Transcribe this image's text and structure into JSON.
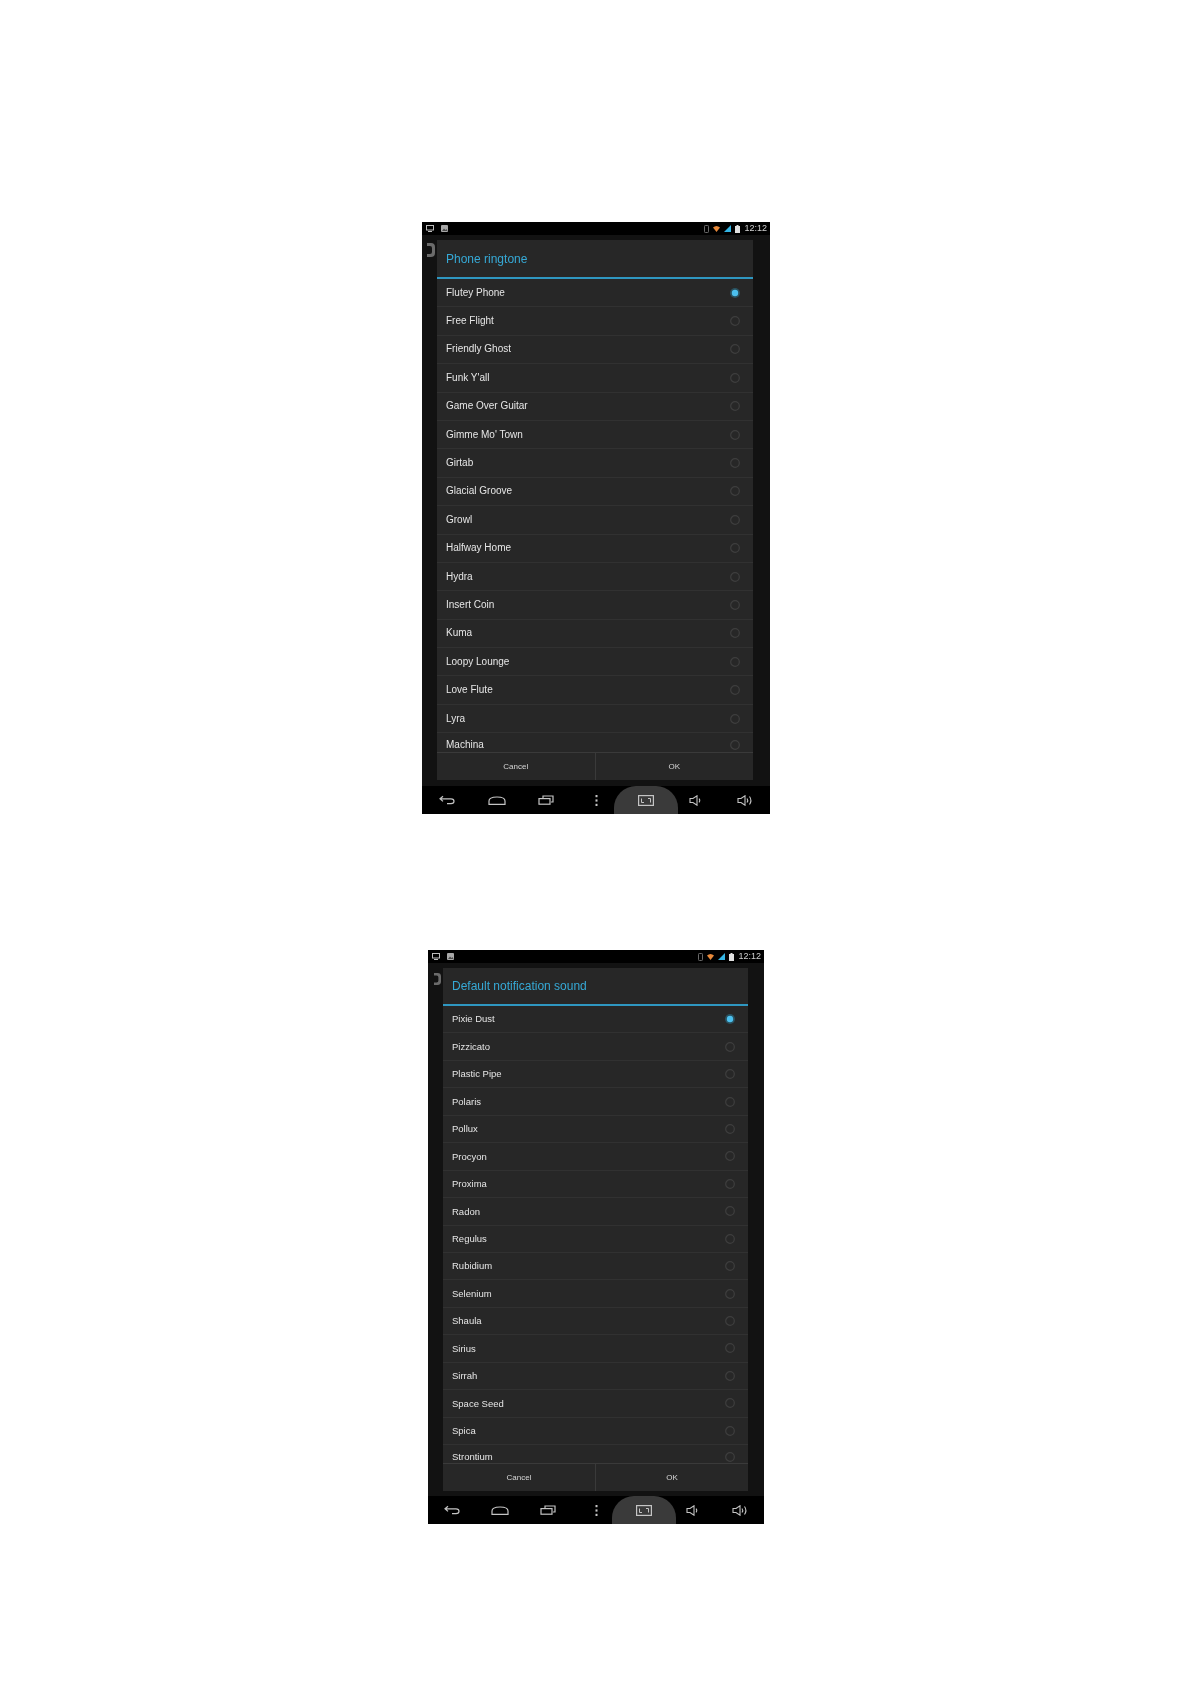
{
  "screens": [
    {
      "status_bar": {
        "time": "12:12"
      },
      "dialog": {
        "title": "Phone ringtone",
        "options": [
          {
            "label": "Flutey Phone",
            "selected": true
          },
          {
            "label": "Free Flight",
            "selected": false
          },
          {
            "label": "Friendly Ghost",
            "selected": false
          },
          {
            "label": "Funk Y'all",
            "selected": false
          },
          {
            "label": "Game Over Guitar",
            "selected": false
          },
          {
            "label": "Gimme Mo' Town",
            "selected": false
          },
          {
            "label": "Girtab",
            "selected": false
          },
          {
            "label": "Glacial Groove",
            "selected": false
          },
          {
            "label": "Growl",
            "selected": false
          },
          {
            "label": "Halfway Home",
            "selected": false
          },
          {
            "label": "Hydra",
            "selected": false
          },
          {
            "label": "Insert Coin",
            "selected": false
          },
          {
            "label": "Kuma",
            "selected": false
          },
          {
            "label": "Loopy Lounge",
            "selected": false
          },
          {
            "label": "Love Flute",
            "selected": false
          },
          {
            "label": "Lyra",
            "selected": false
          },
          {
            "label": "Machina",
            "selected": false
          }
        ],
        "buttons": [
          "Cancel",
          "OK"
        ]
      },
      "nav_bar": [
        {
          "kind": "back",
          "pressed": false
        },
        {
          "kind": "home",
          "pressed": false
        },
        {
          "kind": "recent",
          "pressed": false
        },
        {
          "kind": "menu",
          "pressed": false
        },
        {
          "kind": "capture",
          "pressed": true
        },
        {
          "kind": "volume_down",
          "pressed": false
        },
        {
          "kind": "volume_up",
          "pressed": false
        }
      ]
    },
    {
      "status_bar": {
        "time": "12:12"
      },
      "dialog": {
        "title": "Default notification sound",
        "options": [
          {
            "label": "Pixie Dust",
            "selected": true
          },
          {
            "label": "Pizzicato",
            "selected": false
          },
          {
            "label": "Plastic Pipe",
            "selected": false
          },
          {
            "label": "Polaris",
            "selected": false
          },
          {
            "label": "Pollux",
            "selected": false
          },
          {
            "label": "Procyon",
            "selected": false
          },
          {
            "label": "Proxima",
            "selected": false
          },
          {
            "label": "Radon",
            "selected": false
          },
          {
            "label": "Regulus",
            "selected": false
          },
          {
            "label": "Rubidium",
            "selected": false
          },
          {
            "label": "Selenium",
            "selected": false
          },
          {
            "label": "Shaula",
            "selected": false
          },
          {
            "label": "Sirius",
            "selected": false
          },
          {
            "label": "Sirrah",
            "selected": false
          },
          {
            "label": "Space Seed",
            "selected": false
          },
          {
            "label": "Spica",
            "selected": false
          },
          {
            "label": "Strontium",
            "selected": false
          }
        ],
        "buttons": [
          "Cancel",
          "OK"
        ]
      },
      "nav_bar": [
        {
          "kind": "back",
          "pressed": false
        },
        {
          "kind": "home",
          "pressed": false
        },
        {
          "kind": "recent",
          "pressed": false
        },
        {
          "kind": "menu",
          "pressed": false
        },
        {
          "kind": "capture",
          "pressed": true
        },
        {
          "kind": "volume_down",
          "pressed": false
        },
        {
          "kind": "volume_up",
          "pressed": false
        }
      ]
    }
  ]
}
